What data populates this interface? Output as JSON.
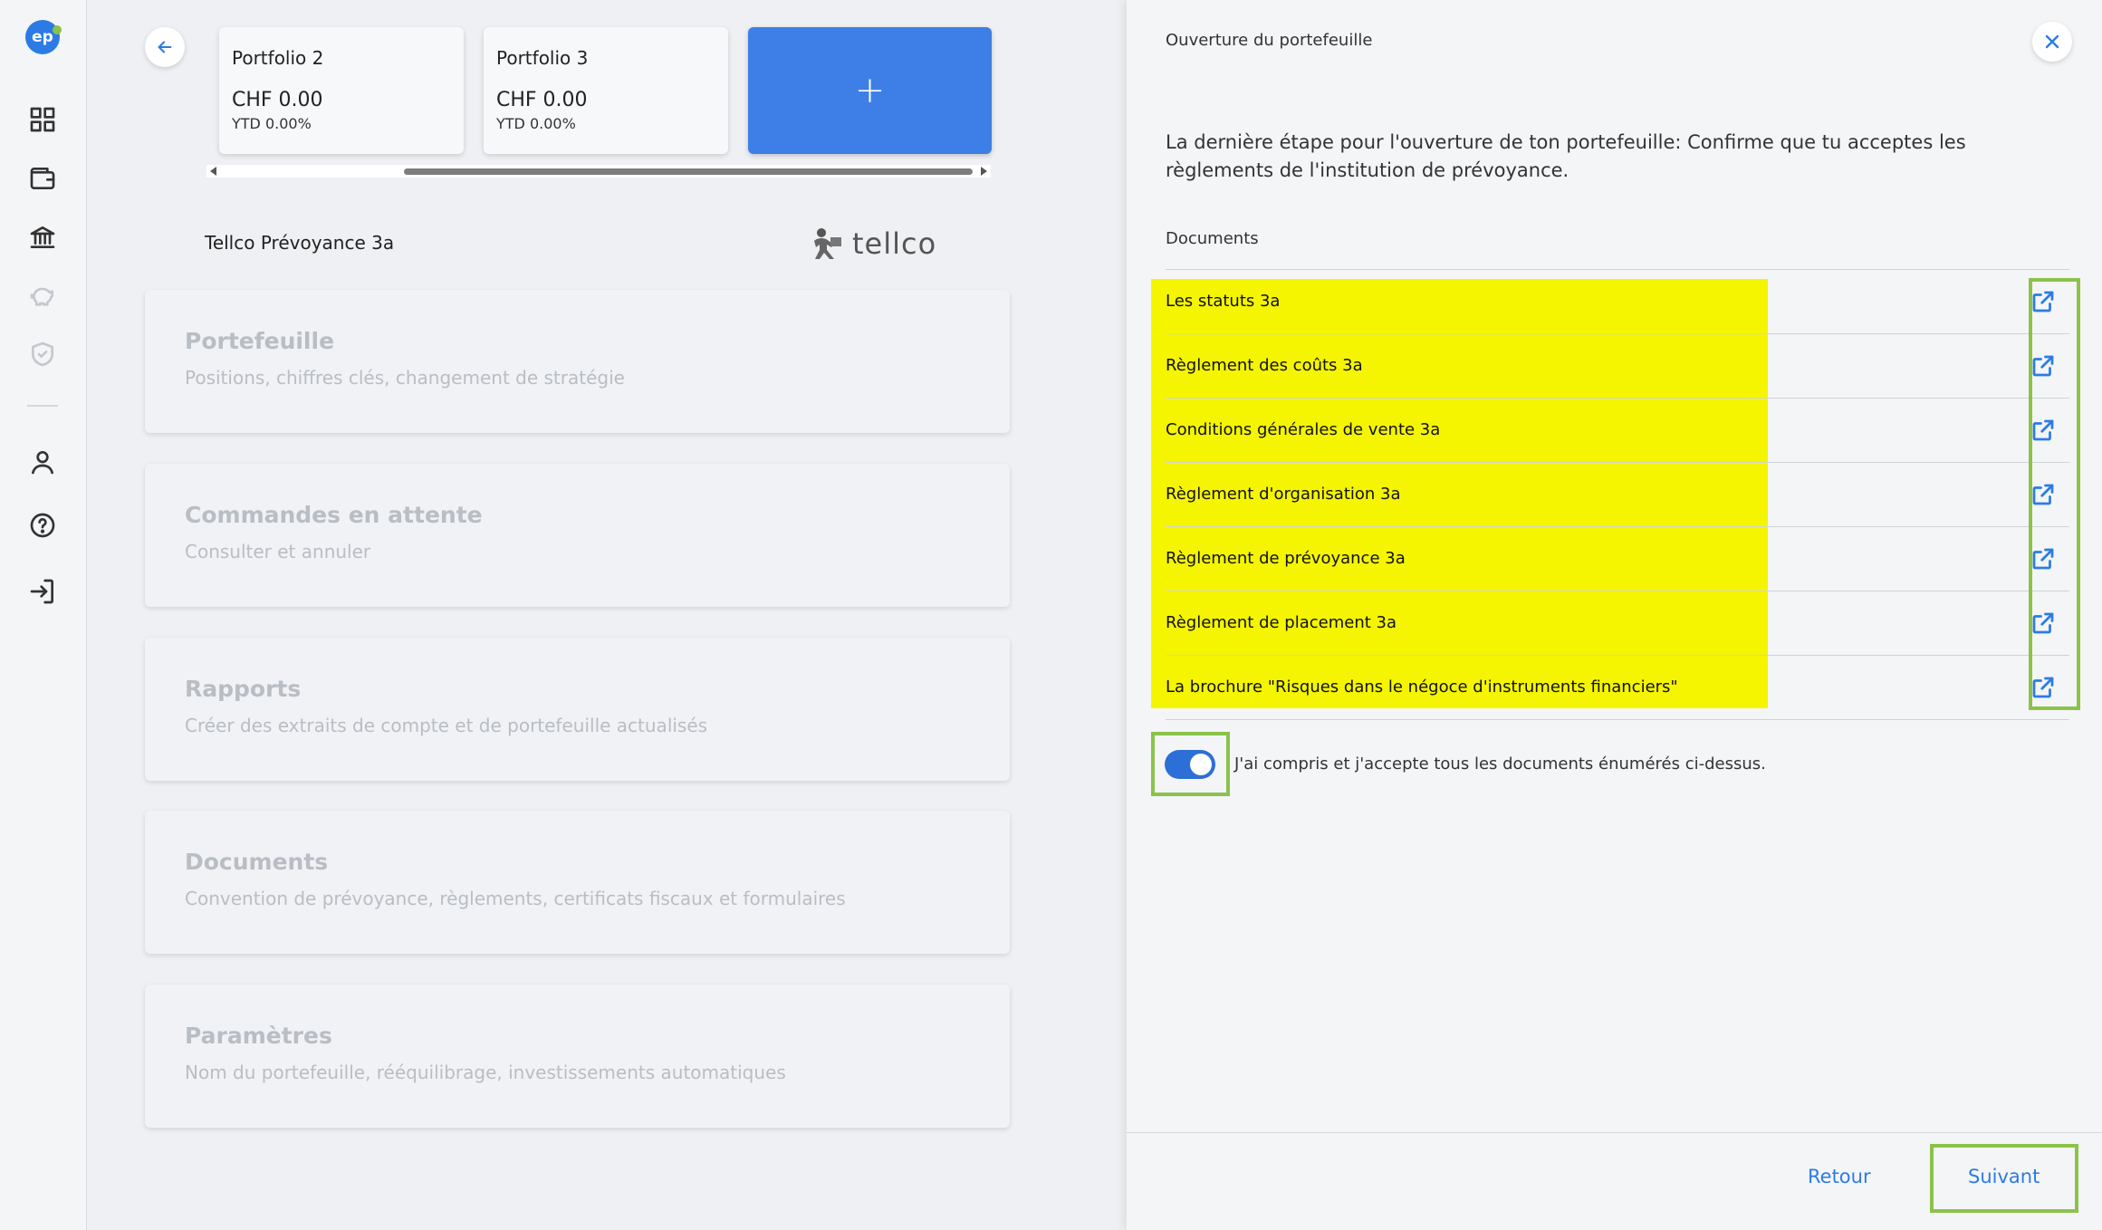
{
  "brand": {
    "logo_text": "ep"
  },
  "portfolios": [
    {
      "name": "Portfolio 2",
      "value": "CHF 0.00",
      "ytd": "YTD 0.00%"
    },
    {
      "name": "Portfolio 3",
      "value": "CHF 0.00",
      "ytd": "YTD 0.00%"
    }
  ],
  "add_portfolio_label": "+",
  "institution": {
    "name": "Tellco Prévoyance 3a",
    "brand_name": "tellco"
  },
  "menu": [
    {
      "title": "Portefeuille",
      "desc": "Positions, chiffres clés, changement de stratégie"
    },
    {
      "title": "Commandes en attente",
      "desc": "Consulter et annuler"
    },
    {
      "title": "Rapports",
      "desc": "Créer des extraits de compte et de portefeuille actualisés"
    },
    {
      "title": "Documents",
      "desc": "Convention de prévoyance, règlements, certificats fiscaux et formulaires"
    },
    {
      "title": "Paramètres",
      "desc": "Nom du portefeuille, rééquilibrage, investissements automatiques"
    }
  ],
  "dialog": {
    "title": "Ouverture du portefeuille",
    "intro": "La dernière étape pour l'ouverture de ton portefeuille: Confirme que tu acceptes les règlements de l'institution de prévoyance.",
    "docs_label": "Documents",
    "documents": [
      "Les statuts 3a",
      "Règlement des coûts 3a",
      "Conditions générales de vente 3a",
      "Règlement d'organisation 3a",
      "Règlement de prévoyance 3a",
      "Règlement de placement 3a",
      "La brochure \"Risques dans le négoce d'instruments financiers\""
    ],
    "accept_text": "J'ai compris et j'accepte tous les documents énumérés ci-dessus.",
    "toggle_on": true,
    "back_label": "Retour",
    "next_label": "Suivant"
  },
  "colors": {
    "accent": "#2c7be5",
    "highlight": "#f5f500",
    "outline": "#8bc34a"
  }
}
